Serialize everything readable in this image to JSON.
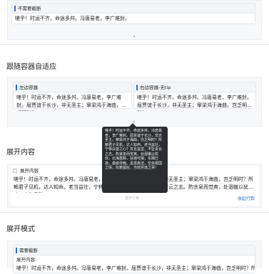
{
  "sections": {
    "follow_title": "跟随容器自适应",
    "expand_content_title": "展开内容",
    "expand_mode_title": "展开模式"
  },
  "top_card": {
    "header": "不需要截断",
    "text": "嗟乎！时运不齐，命途多舛。冯唐易老，李广难封。"
  },
  "left_card": {
    "header": "左边容器",
    "text": "嗟乎！时运不齐，命途多舛。冯唐易老，李广难封。屈贾谊于长沙，非无圣主；窜梁鸿于海曲，岂乏明时？..."
  },
  "right_card": {
    "header": "右边容器-无tip",
    "text": "嗟乎！时运不齐，命途多舛。冯唐易老，李广难封。屈贾谊于长沙，非无圣主；窜梁鸿于海曲，岂乏明时？..."
  },
  "tooltip": {
    "text": "嗟乎！时运不齐，命途多舛。冯唐易老，李广难封。屈贾谊于长沙，非无圣主；窜梁鸿于海曲，岂乏明时？所赖君子见机，达人知命。老当益壮，宁移白首之心？穷且益坚，不坠青云之志。酌贪泉而觉爽，处涸辙以犹欢。北海虽赊，扶摇可接；东隅已逝，桑榆非晚。孟尝高洁，空余报国之情；阮籍猖狂，岂效穷途之哭！"
  },
  "expand_card": {
    "header": "展开内容",
    "text": "嗟乎！时运不齐，命途多舛。冯唐易老，李广难封。屈贾谊于长沙，非无圣主；窜梁鸿于海曲，岂乏明时？所赖君子见机，达人知命。老当益壮，宁移白首之心？穷且益坚，不坠青云之志。酌贪泉而觉爽，处涸辙以犹欢，北海虽赊，",
    "faded": "展开行数",
    "link": "收起行数"
  },
  "mode_card": {
    "header": "需要截断",
    "sub": "展开内容",
    "text": "嗟乎！时运不齐，命途多舛。冯唐易老，李广难封。屈贾谊于长沙，非无圣主；窜梁鸿于海曲，岂乏明时？所赖君"
  }
}
